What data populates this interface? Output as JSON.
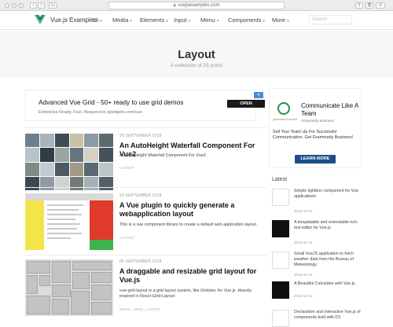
{
  "browser": {
    "url": "vuejsexamples.com",
    "back_icon": "chevron-left-icon",
    "forward_icon": "chevron-right-icon"
  },
  "nav": {
    "brand": "Vue.js Examples",
    "menu": [
      "Ui",
      "Media",
      "Elements",
      "Input",
      "Menu",
      "Components",
      "More"
    ],
    "search_placeholder": "Search"
  },
  "hero": {
    "title": "Layout",
    "subtitle": "A collection of 25 posts"
  },
  "ad": {
    "title": "Advanced Vue Grid - 50+ ready to use grid demos",
    "subtitle": "Enterprise Ready, Fast, Responsive jqwidgets.com/vue",
    "button": "OPEN",
    "close": "✕"
  },
  "side_ad": {
    "title": "Communicate Like A Team",
    "brand": "Grammarly Business",
    "logo_sub": "grammarly business",
    "body": "Sell Your Team Up For Successful Communication. Get Grammarly Business!",
    "button": "LEARN MORE"
  },
  "latest": {
    "heading": "Latest",
    "items": [
      {
        "title": "Simple lightbox component for Vue applications",
        "date": "2018-10-14"
      },
      {
        "title": "A templatable and extendable rich-text editor for Vue.js",
        "date": "2018-10-14"
      },
      {
        "title": "Small VueJS application to fetch weather data from the Bureau of Meteorology",
        "date": "2018-10-14"
      },
      {
        "title": "A Beautiful Calculator with Vue.js",
        "date": "2018-10-13"
      },
      {
        "title": "Declarative and Interactive Vue.js of components built with D3",
        "date": ""
      }
    ]
  },
  "posts": [
    {
      "date": "30 SEPTEMBER 2018",
      "title": "An AutoHeight Waterfall Component For Vue2",
      "excerpt": "An AutoHeight Waterfall Component For Vue2.",
      "tag": "LAYOUT"
    },
    {
      "date": "29 SEPTEMBER 2018",
      "title": "A Vue plugin to quickly generate a webapplication layout",
      "excerpt": "This is a vue component library to create a default web application layout.",
      "tag": "LAYOUT"
    },
    {
      "date": "05 SEPTEMBER 2018",
      "title": "A draggable and resizable grid layout for Vue.js",
      "excerpt": "vue-grid-layout is a grid layout system, like Gridster, for Vue.js. Heavily inspired in React-Grid-Layout",
      "tag": "DRAG, GRID, LAYOUT"
    }
  ]
}
